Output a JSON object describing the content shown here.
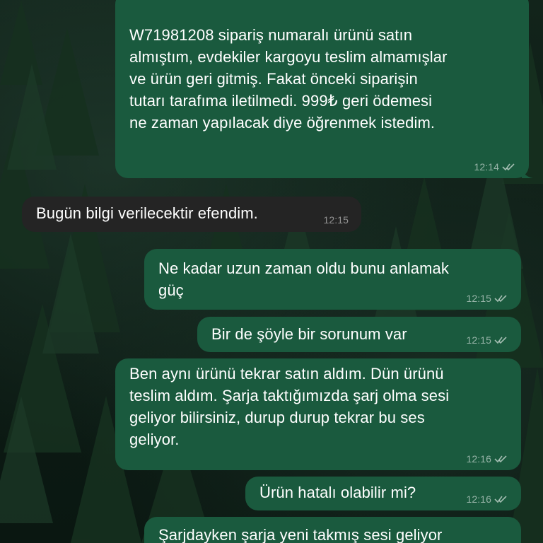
{
  "messages": [
    {
      "direction": "out",
      "text": "W71981208 sipariş numaralı ürünü satın\nalmıştım, evdekiler kargoyu teslim almamışlar\nve ürün geri gitmiş. Fakat önceki siparişin\ntutarı tarafıma iletilmedi. 999₺ geri ödemesi\nne zaman yapılacak diye öğrenmek istedim.",
      "time": "12:14",
      "status": "read-ticks-icon"
    },
    {
      "direction": "in",
      "text": "Bugün bilgi verilecektir efendim.",
      "time": "12:15"
    },
    {
      "direction": "out",
      "text": "Ne kadar uzun zaman oldu bunu anlamak\ngüç",
      "time": "12:15",
      "status": "read-ticks-icon"
    },
    {
      "direction": "out",
      "text": "Bir de şöyle bir sorunum var",
      "time": "12:15",
      "status": "read-ticks-icon"
    },
    {
      "direction": "out",
      "text": "Ben aynı ürünü tekrar satın aldım. Dün ürünü\nteslim aldım. Şarja taktığımızda şarj olma sesi\ngeliyor bilirsiniz, durup durup tekrar bu ses\ngeliyor.",
      "time": "12:16",
      "status": "read-ticks-icon"
    },
    {
      "direction": "out",
      "text": "Ürün hatalı olabilir mi?",
      "time": "12:16",
      "status": "read-ticks-icon"
    },
    {
      "direction": "out",
      "text": "Şarjdayken şarja yeni takmış sesi geliyor"
    }
  ],
  "colors": {
    "outgoing_bubble": "#1a5a3e",
    "incoming_bubble": "#242424",
    "wallpaper": "#0d1c15"
  }
}
